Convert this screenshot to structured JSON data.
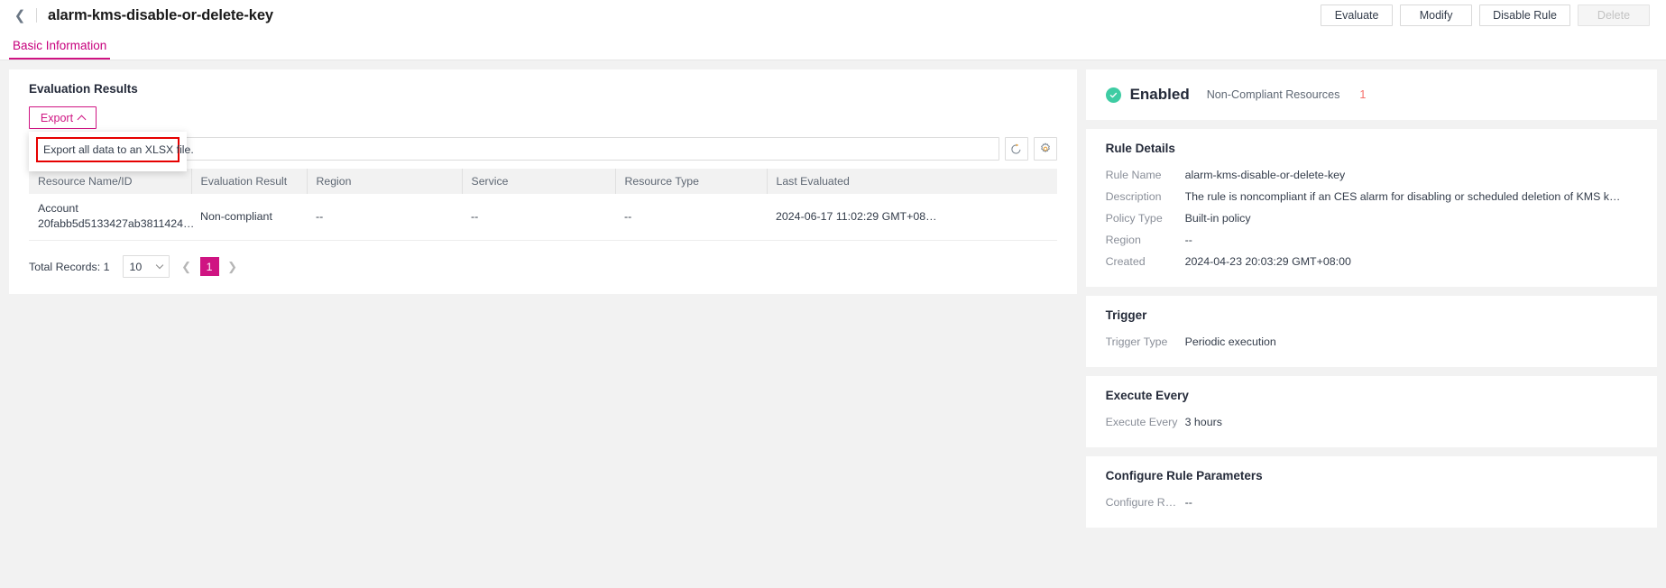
{
  "header": {
    "back_icon": "chevron-left-icon",
    "title": "alarm-kms-disable-or-delete-key",
    "actions": [
      {
        "label": "Evaluate",
        "disabled": false
      },
      {
        "label": "Modify",
        "disabled": false
      },
      {
        "label": "Disable Rule",
        "disabled": false
      },
      {
        "label": "Delete",
        "disabled": true
      }
    ]
  },
  "tabs": [
    {
      "label": "Basic Information",
      "active": true
    }
  ],
  "evaluation": {
    "section_title": "Evaluation Results",
    "export_label": "Export",
    "export_chevron": "chevron-up-icon",
    "export_menu": [
      {
        "label": "Export all data to an XLSX file."
      }
    ],
    "search_placeholder": "",
    "search_value": "",
    "refresh_icon": "refresh-icon",
    "settings_icon": "gear-icon",
    "columns": [
      "Resource Name/ID",
      "Evaluation Result",
      "Region",
      "Service",
      "Resource Type",
      "Last Evaluated"
    ],
    "rows": [
      {
        "resource_name": "Account",
        "resource_id": "20fabb5d5133427ab3811424…",
        "result": "Non-compliant",
        "region": "--",
        "service": "--",
        "resource_type": "--",
        "last_evaluated": "2024-06-17 11:02:29 GMT+08…"
      }
    ],
    "pagination": {
      "total_label": "Total Records: 1",
      "page_size": "10",
      "prev_icon": "chevron-left-icon",
      "next_icon": "chevron-right-icon",
      "current_page": "1"
    }
  },
  "status": {
    "icon": "check-circle-icon",
    "state": "Enabled",
    "noncompliant_label": "Non-Compliant Resources",
    "noncompliant_count": "1"
  },
  "rule_details": {
    "title": "Rule Details",
    "fields": [
      {
        "key": "Rule Name",
        "value": "alarm-kms-disable-or-delete-key"
      },
      {
        "key": "Description",
        "value": "The rule is noncompliant if an CES alarm for disabling or scheduled deletion of KMS k…"
      },
      {
        "key": "Policy Type",
        "value": "Built-in policy"
      },
      {
        "key": "Region",
        "value": "--"
      },
      {
        "key": "Created",
        "value": "2024-04-23 20:03:29 GMT+08:00"
      }
    ]
  },
  "trigger": {
    "title": "Trigger",
    "fields": [
      {
        "key": "Trigger Type",
        "value": "Periodic execution"
      }
    ]
  },
  "execute_every": {
    "title": "Execute Every",
    "fields": [
      {
        "key": "Execute Every",
        "value": "3 hours"
      }
    ]
  },
  "configure_rule_parameters": {
    "title": "Configure Rule Parameters",
    "fields": [
      {
        "key": "Configure R…",
        "value": "--"
      }
    ]
  },
  "colors": {
    "accent": "#cf1482",
    "danger": "#f66f6a",
    "success": "#3ecca3",
    "annotation": "#e60000"
  }
}
